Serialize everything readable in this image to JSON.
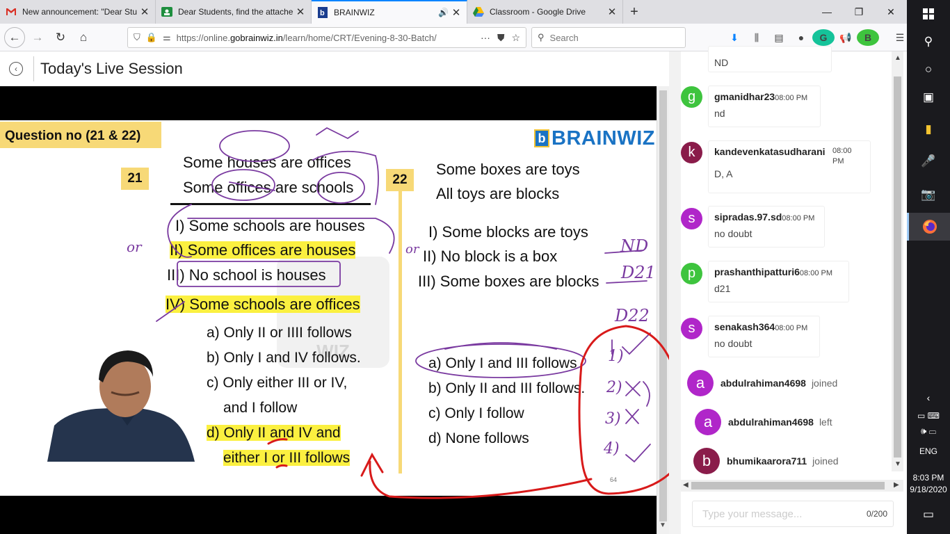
{
  "browser": {
    "tabs": [
      {
        "title": "New announcement: \"Dear Stu",
        "favicon": "gmail-icon",
        "active": false
      },
      {
        "title": "Dear Students, find the attache",
        "favicon": "classroom-icon",
        "active": false
      },
      {
        "title": "BRAINWIZ",
        "favicon": "brainwiz-icon",
        "active": true,
        "audio": true
      },
      {
        "title": "Classroom - Google Drive",
        "favicon": "drive-icon",
        "active": false
      }
    ],
    "url_prefix": "https://online.",
    "url_host": "gobrainwiz.in",
    "url_path": "/learn/home/CRT/Evening-8-30-Batch/",
    "search_placeholder": "Search",
    "more_label": "···"
  },
  "page": {
    "title": "Today's Live Session"
  },
  "slide": {
    "header": "Question no (21 & 22)",
    "logo_text": "BRAINWIZ",
    "logo_mark": "b",
    "watermark": "WIZ",
    "q21": {
      "number": "21",
      "premises": [
        "Some houses are offices",
        "Some offices are schools"
      ],
      "conclusions": [
        "I) Some schools are houses",
        "II) Some offices are houses",
        "III) No school is houses",
        "IV) Some schools are offices"
      ],
      "options": [
        "a) Only II or IIII follows",
        "b) Only I and IV follows.",
        "c) Only either III or IV,",
        "and I follow",
        "d) Only II and IV and",
        "either I or III follows"
      ]
    },
    "q22": {
      "number": "22",
      "premises": [
        "Some boxes are toys",
        "All toys are blocks"
      ],
      "conclusions": [
        "I) Some blocks are toys",
        "II) No block is a box",
        "III) Some boxes are blocks"
      ],
      "options": [
        "a) Only I and III follows",
        "b) Only II and III follows.",
        "c) Only I follow",
        "d) None follows"
      ]
    },
    "page_number": "64"
  },
  "annotations": {
    "nd": "ND",
    "d21": "D21",
    "d22": "D22",
    "or_left": "or",
    "or_right": "or"
  },
  "chat": {
    "partial_message": "ND",
    "messages": [
      {
        "avatar": "g",
        "color": "#3ec43e",
        "user": "gmanidhar23",
        "time": "08:00 PM",
        "text": "nd"
      },
      {
        "avatar": "k",
        "color": "#8a1c4a",
        "user": "kandevenkatasudharani",
        "time": "08:00 PM",
        "text": "D, A"
      },
      {
        "avatar": "s",
        "color": "#b026c9",
        "user": "sipradas.97.sd",
        "time": "08:00 PM",
        "text": "no doubt"
      },
      {
        "avatar": "p",
        "color": "#3ec43e",
        "user": "prashanthipatturi6",
        "time": "08:00 PM",
        "text": "d21"
      },
      {
        "avatar": "s",
        "color": "#b026c9",
        "user": "senakash364",
        "time": "08:00 PM",
        "text": "no doubt"
      }
    ],
    "events": [
      {
        "avatar": "a",
        "color": "#b026c9",
        "user": "abdulrahiman4698",
        "action": "joined"
      },
      {
        "avatar": "a",
        "color": "#b026c9",
        "user": "abdulrahiman4698",
        "action": "left"
      },
      {
        "avatar": "b",
        "color": "#8a1c4a",
        "user": "bhumikaarora711",
        "action": "joined"
      }
    ],
    "input_placeholder": "Type your message...",
    "char_count": "0/200"
  },
  "taskbar": {
    "time": "8:03 PM",
    "date": "9/18/2020",
    "language": "ENG"
  }
}
